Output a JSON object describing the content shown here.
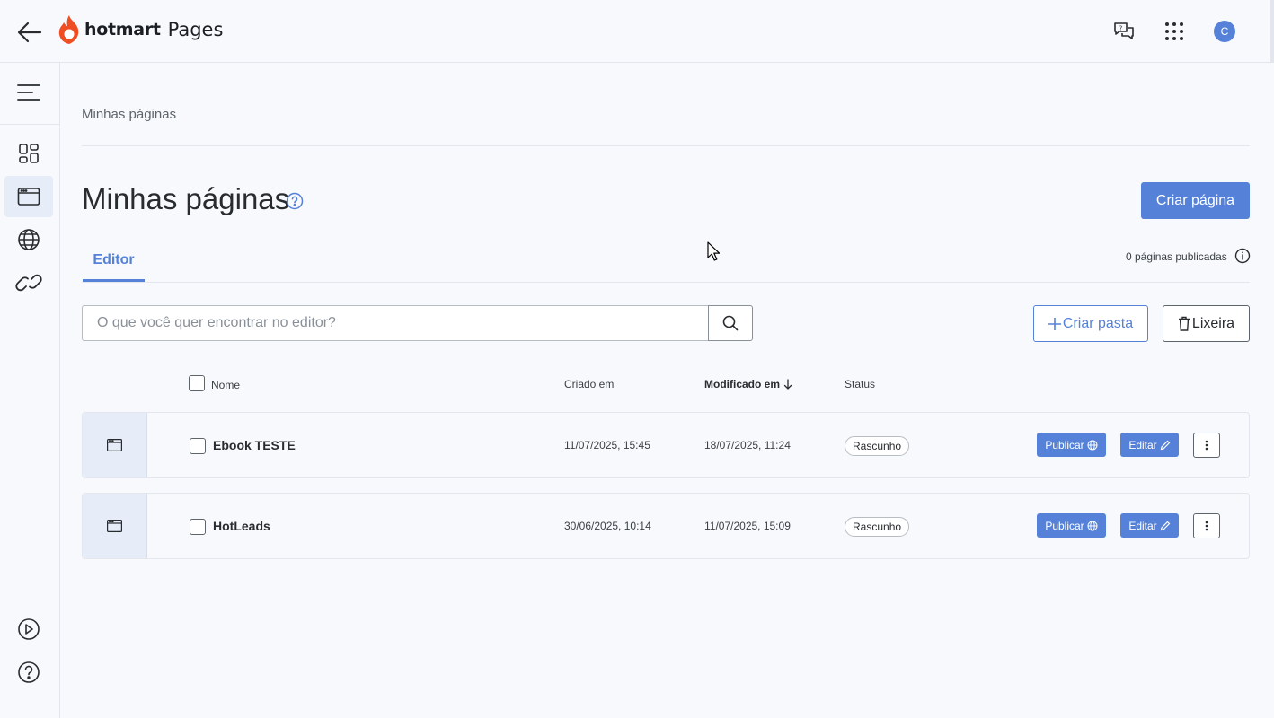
{
  "header": {
    "brand": "hotmart",
    "product": "Pages",
    "avatar_initial": "C",
    "accent_color": "#5582d8",
    "brand_color": "#ef4e23",
    "icons": [
      "back-arrow-icon",
      "support-chat-icon",
      "apps-grid-icon"
    ]
  },
  "sidebar": {
    "items": [
      {
        "name": "dashboard",
        "icon": "dashboard-icon",
        "active": false
      },
      {
        "name": "pages",
        "icon": "page-icon",
        "active": true
      },
      {
        "name": "domains",
        "icon": "globe-icon",
        "active": false
      },
      {
        "name": "links",
        "icon": "link-icon",
        "active": false
      }
    ],
    "bottom_items": [
      {
        "name": "tutorials",
        "icon": "play-circle-icon"
      },
      {
        "name": "help",
        "icon": "help-circle-icon"
      }
    ]
  },
  "main": {
    "breadcrumb": "Minhas páginas",
    "title": "Minhas páginas",
    "create_page_label": "Criar página",
    "tab_label": "Editor",
    "published_count_text": "0 páginas publicadas",
    "search_placeholder": "O que você quer encontrar no editor?",
    "create_folder_label": "Criar pasta",
    "trash_label": "Lixeira"
  },
  "table": {
    "headers": {
      "name": "Nome",
      "created": "Criado em",
      "modified": "Modificado em",
      "status": "Status"
    },
    "sort": {
      "column": "modified",
      "direction": "desc"
    },
    "rows": [
      {
        "name": "Ebook TESTE",
        "created": "11/07/2025, 15:45",
        "modified": "18/07/2025, 11:24",
        "status": "Rascunho",
        "publish_label": "Publicar",
        "edit_label": "Editar"
      },
      {
        "name": "HotLeads",
        "created": "30/06/2025, 10:14",
        "modified": "11/07/2025, 15:09",
        "status": "Rascunho",
        "publish_label": "Publicar",
        "edit_label": "Editar"
      }
    ]
  }
}
